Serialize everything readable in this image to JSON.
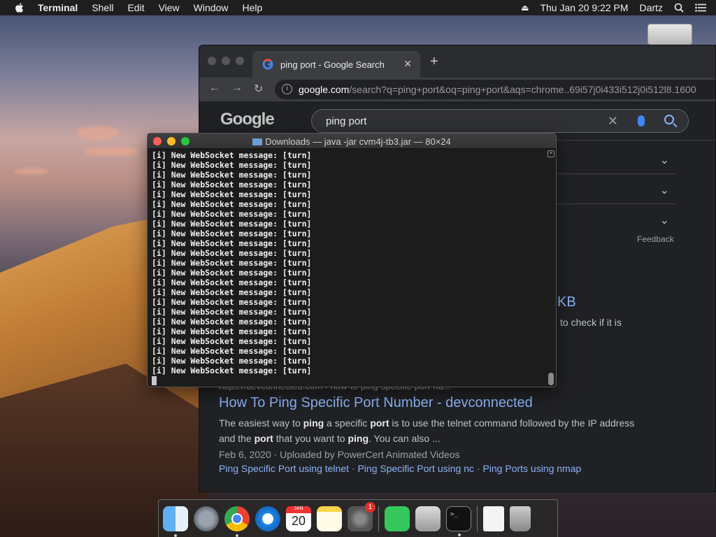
{
  "menubar": {
    "app": "Terminal",
    "menus": [
      "Shell",
      "Edit",
      "View",
      "Window",
      "Help"
    ],
    "datetime": "Thu Jan 20  9:22 PM",
    "user": "Dartz"
  },
  "browser": {
    "tab_title": "ping port - Google Search",
    "url_host": "google.com",
    "url_path": "/search?q=ping+port&oq=ping+port&aqs=chrome..69i57j0i433i512j0i512l8.1600",
    "logo": "Google",
    "search_query": "ping port",
    "feedback": "Feedback",
    "partial_title": "KB",
    "partial_snippet": "to check if it is",
    "result": {
      "cite": "https://devconnected.com › how-to-ping-specific-port-nu...",
      "title": "How To Ping Specific Port Number - devconnected",
      "snippet_1": "The easiest way to ",
      "snippet_b1": "ping",
      "snippet_2": " a specific ",
      "snippet_b2": "port",
      "snippet_3": " is to use the telnet command followed by the IP address",
      "snippet_4": "and the ",
      "snippet_b3": "port",
      "snippet_5": " that you want to ",
      "snippet_b4": "ping",
      "snippet_6": ". You can also ...",
      "meta": "Feb 6, 2020 · Uploaded by PowerCert Animated Videos",
      "links": [
        "Ping Specific Port using telnet",
        "Ping Specific Port using nc",
        "Ping Ports using nmap"
      ]
    }
  },
  "terminal": {
    "title": "Downloads — java -jar cvm4j-tb3.jar — 80×24",
    "lines": [
      "[i] New WebSocket message: [turn]",
      "[i] New WebSocket message: [turn]",
      "[i] New WebSocket message: [turn]",
      "[i] New WebSocket message: [turn]",
      "[i] New WebSocket message: [turn]",
      "[i] New WebSocket message: [turn]",
      "[i] New WebSocket message: [turn]",
      "[i] New WebSocket message: [turn]",
      "[i] New WebSocket message: [turn]",
      "[i] New WebSocket message: [turn]",
      "[i] New WebSocket message: [turn]",
      "[i] New WebSocket message: [turn]",
      "[i] New WebSocket message: [turn]",
      "[i] New WebSocket message: [turn]",
      "[i] New WebSocket message: [turn]",
      "[i] New WebSocket message: [turn]",
      "[i] New WebSocket message: [turn]",
      "[i] New WebSocket message: [turn]",
      "[i] New WebSocket message: [turn]",
      "[i] New WebSocket message: [turn]",
      "[i] New WebSocket message: [turn]",
      "[i] New WebSocket message: [turn]",
      "[i] New WebSocket message: [turn]"
    ]
  },
  "dock": {
    "calendar_month": "JAN",
    "calendar_day": "20",
    "prefs_badge": "1",
    "terminal_prompt": ">_"
  }
}
